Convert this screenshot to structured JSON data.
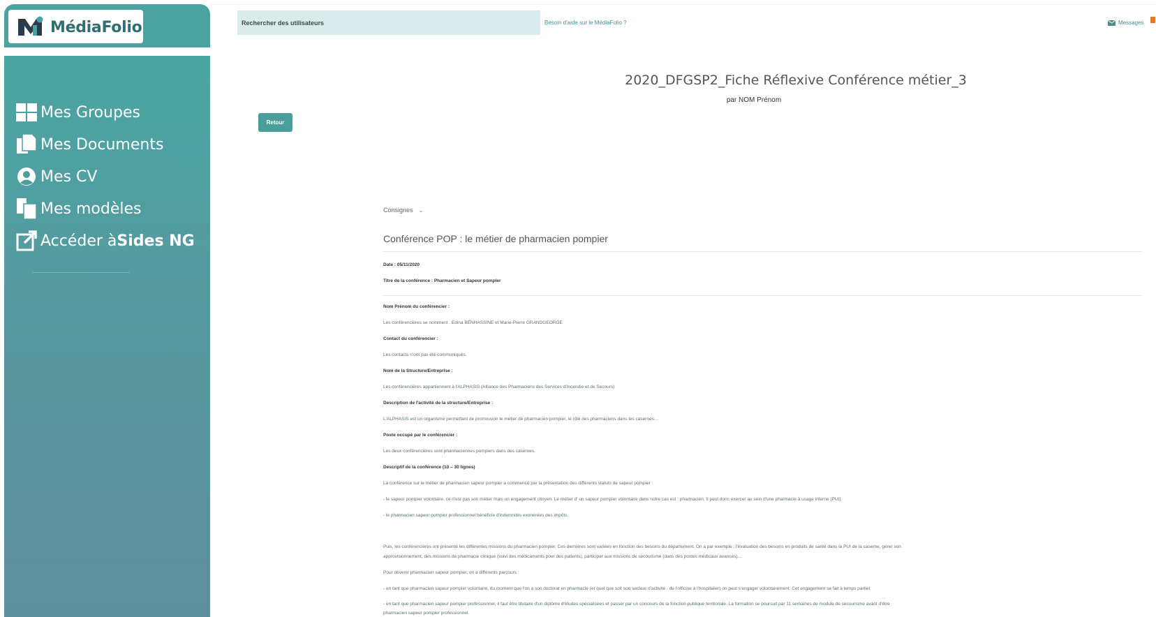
{
  "app": {
    "name": "MédiaFolio",
    "accent": "#4aa3a0",
    "sidebar_gradient": [
      "#4aa6a3",
      "#5f8f9d"
    ]
  },
  "sidebar": {
    "items": [
      {
        "icon": "grid-icon",
        "label": "Mes Groupes"
      },
      {
        "icon": "documents-icon",
        "label": "Mes Documents"
      },
      {
        "icon": "user-circle-icon",
        "label": "Mes CV"
      },
      {
        "icon": "templates-icon",
        "label": "Mes modèles"
      },
      {
        "icon": "external-link-icon",
        "label": "Accéder à ",
        "label_bold": "Sides NG"
      }
    ]
  },
  "topbar": {
    "search_placeholder": "Rechercher des utilisateurs",
    "help_link": "Besoin d'aide sur le MédiaFolio ?",
    "messages_label": "Messages"
  },
  "header": {
    "title": "2020_DFGSP2_Fiche Réflexive Conférence métier_3",
    "author": "par NOM Prénom",
    "back_button": "Retour"
  },
  "content": {
    "consignes_label": "Consignes",
    "section_title": "Conférence POP : le métier de pharmacien pompier",
    "lines": [
      {
        "text": "Date : 05/11/2020",
        "bold": true
      },
      {
        "text": "Titre de la conférence : Pharmacien et Sapeur pompier",
        "bold": true
      },
      {
        "text": "Nom Prénom du conférencier :",
        "bold": true
      },
      {
        "text": "Les conférencières se nomment : Edina BENHASSINE et Marie-Pierre GRANDGEORGE",
        "bold": false
      },
      {
        "text": "Contact du conférencier :",
        "bold": true
      },
      {
        "text": "Les contacts n'ont pas été communiqués.",
        "bold": false
      },
      {
        "text": "Nom de la Structure/Entreprise :",
        "bold": true
      },
      {
        "text": "Les conférencières appartiennent à l'ALPHASIS (Alliance des Pharmaciens des Services d'Incendie et de Secours)",
        "bold": false
      },
      {
        "text": "Description de l'activité de la structure/Entreprise :",
        "bold": true
      },
      {
        "text": "L'ALPHASIS est un organisme permettant de promouvoir le métier de pharmacien pompier, le rôle des pharmaciens dans les casernes...",
        "bold": false
      },
      {
        "text": "Poste occupé par le conférencier :",
        "bold": true
      },
      {
        "text": "Les deux conférencières sont pharmaciennes pompiers dans des casernes.",
        "bold": false
      },
      {
        "text": "Descriptif de la conférence (10 – 30 lignes)",
        "bold": true
      },
      {
        "text": "La conférence sur le métier de pharmacien sapeur pompier a commencé par la présentation des différents statuts de sapeur pompier :",
        "bold": false
      },
      {
        "text": "- le sapeur pompier volontaire, ce n'est pas son métier mais un engagement citoyen. Le métier d' un sapeur pompier volontaire dans notre cas est : pharmacien. Il peut donc exercer au sein d'une pharmacie à usage interne (PUI).",
        "bold": false
      },
      {
        "text": "- le pharmacien sapeur pompier professionnel bénéficie d'indemnités exonérées des impôts.",
        "bold": false
      },
      {
        "text": "Puis, les conférencières ont présenté les différentes missions du pharmacien pompier. Ces dernières sont variées en fonction des besoins du département. On a par exemple : l'évaluation des besoins en produits de santé dans la PUI de la caserne, gérer son",
        "bold": false
      },
      {
        "text": "approvisionnement, des missions de pharmacie clinique (suivi des médicaments pour des patients), participer aux missions de secourisme (dans des postes médicaux avancés)...",
        "bold": false
      },
      {
        "text": "Pour devenir pharmacien sapeur pompier, on a différents parcours :",
        "bold": false
      },
      {
        "text": "- en tant que pharmacien sapeur pompier volontaire, du moment que l'on a son doctorat en pharmacie (et quel que soit son secteur d'activité : de l'officine à l'hospitalier) on peut s'engager volontairement. Cet engagement se fait à temps partiel.",
        "bold": false
      },
      {
        "text": "- en tant que pharmacien sapeur pompier professionnel, il faut être titulaire d'un diplôme d'études spécialisées et passer par un concours de la fonction publique territoriale. La formation se poursuit par 11 semaines de module de secourisme avant d'être",
        "bold": false
      },
      {
        "text": "pharmacien sapeur pompier professionnel.",
        "bold": false
      }
    ]
  }
}
